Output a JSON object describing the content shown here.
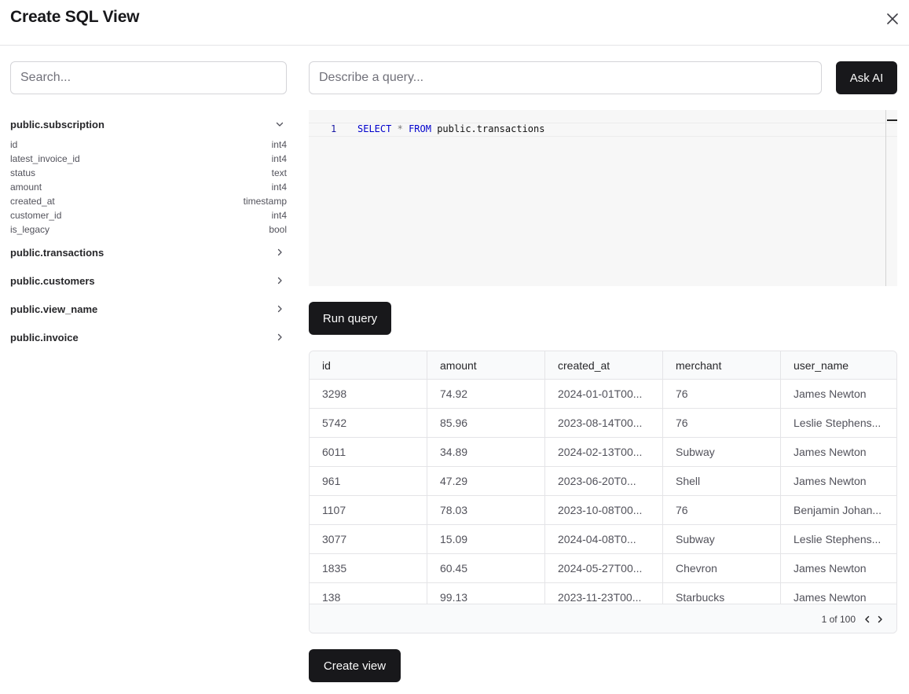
{
  "dialog": {
    "title": "Create SQL View",
    "close_icon": "close-icon"
  },
  "sidebar": {
    "search_placeholder": "Search...",
    "tables": [
      {
        "name": "public.subscription",
        "expanded": true,
        "columns": [
          {
            "name": "id",
            "type": "int4"
          },
          {
            "name": "latest_invoice_id",
            "type": "int4"
          },
          {
            "name": "status",
            "type": "text"
          },
          {
            "name": "amount",
            "type": "int4"
          },
          {
            "name": "created_at",
            "type": "timestamp"
          },
          {
            "name": "customer_id",
            "type": "int4"
          },
          {
            "name": "is_legacy",
            "type": "bool"
          }
        ]
      },
      {
        "name": "public.transactions",
        "expanded": false
      },
      {
        "name": "public.customers",
        "expanded": false
      },
      {
        "name": "public.view_name",
        "expanded": false
      },
      {
        "name": "public.invoice",
        "expanded": false
      }
    ]
  },
  "query": {
    "describe_placeholder": "Describe a query...",
    "ask_label": "Ask AI",
    "line_number": "1",
    "code": {
      "kw1": "SELECT",
      "star": "*",
      "kw2": "FROM",
      "table": "public.transactions"
    },
    "run_label": "Run query"
  },
  "results": {
    "columns": [
      "id",
      "amount",
      "created_at",
      "merchant",
      "user_name"
    ],
    "rows": [
      [
        "3298",
        "74.92",
        "2024-01-01T00...",
        "76",
        "James Newton"
      ],
      [
        "5742",
        "85.96",
        "2023-08-14T00...",
        "76",
        "Leslie Stephens..."
      ],
      [
        "6011",
        "34.89",
        "2024-02-13T00...",
        "Subway",
        "James Newton"
      ],
      [
        "961",
        "47.29",
        "2023-06-20T0...",
        "Shell",
        "James Newton"
      ],
      [
        "1107",
        "78.03",
        "2023-10-08T00...",
        "76",
        "Benjamin Johan..."
      ],
      [
        "3077",
        "15.09",
        "2024-04-08T0...",
        "Subway",
        "Leslie Stephens..."
      ],
      [
        "1835",
        "60.45",
        "2024-05-27T00...",
        "Chevron",
        "James Newton"
      ],
      [
        "138",
        "99.13",
        "2023-11-23T00...",
        "Starbucks",
        "James Newton"
      ]
    ],
    "pagination": "1 of 100"
  },
  "footer": {
    "create_label": "Create view"
  },
  "colors": {
    "primary_button": "#18181b",
    "border": "#e4e4e7",
    "editor_bg": "#f7f7f7",
    "keyword": "#0000cc"
  }
}
